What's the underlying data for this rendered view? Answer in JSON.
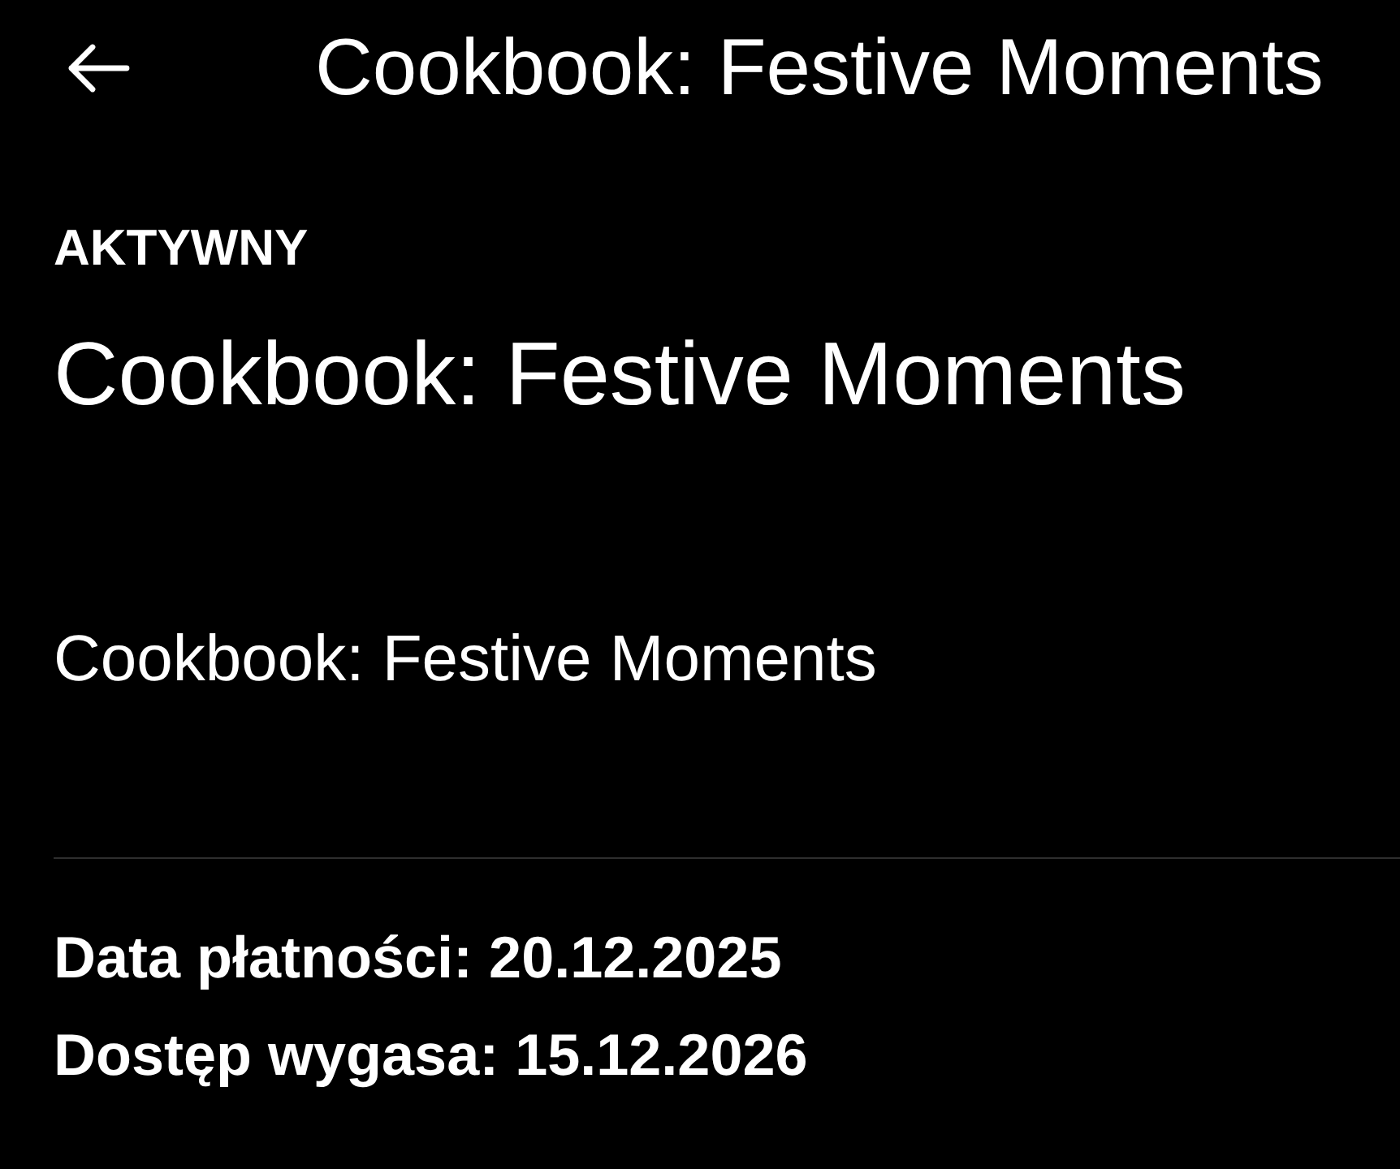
{
  "header": {
    "title": "Cookbook: Festive Moments"
  },
  "status": "AKTYWNY",
  "title": "Cookbook: Festive Moments",
  "subtitle": "Cookbook: Festive Moments",
  "details": [
    "Data płatności: 20.12.2025",
    "Dostęp wygasa: 15.12.2026"
  ]
}
